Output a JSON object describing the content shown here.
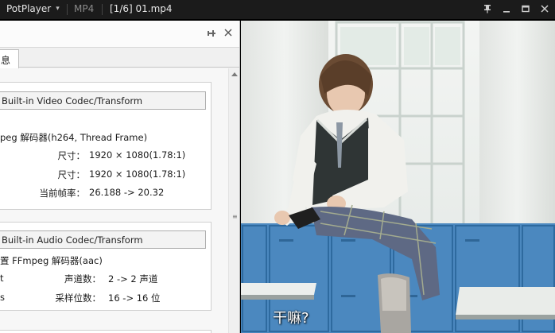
{
  "titlebar": {
    "app_name": "PotPlayer",
    "format": "MP4",
    "file_title": "[1/6] 01.mp4"
  },
  "panel": {
    "tab_label": "息",
    "video": {
      "codec_button": "Built-in Video Codec/Transform",
      "decoder": "peg 解码器(h264, Thread Frame)",
      "size_label_1": "尺寸：",
      "size_value_1": "1920 × 1080(1.78:1)",
      "size_label_2": "尺寸：",
      "size_value_2": "1920 × 1080(1.78:1)",
      "framerate_label": "当前帧率：",
      "framerate_value": "26.188 -> 20.32"
    },
    "audio": {
      "codec_button": "Built-in Audio Codec/Transform",
      "decoder": "置 FFmpeg 解码器(aac)",
      "row1_prefix": "t",
      "channels_label": "声道数：",
      "channels_value": "2 -> 2 声道",
      "row2_prefix": "s",
      "bits_label": "采样位数：",
      "bits_value": "16 -> 16 位"
    }
  },
  "video": {
    "subtitle": "干嘛?"
  }
}
